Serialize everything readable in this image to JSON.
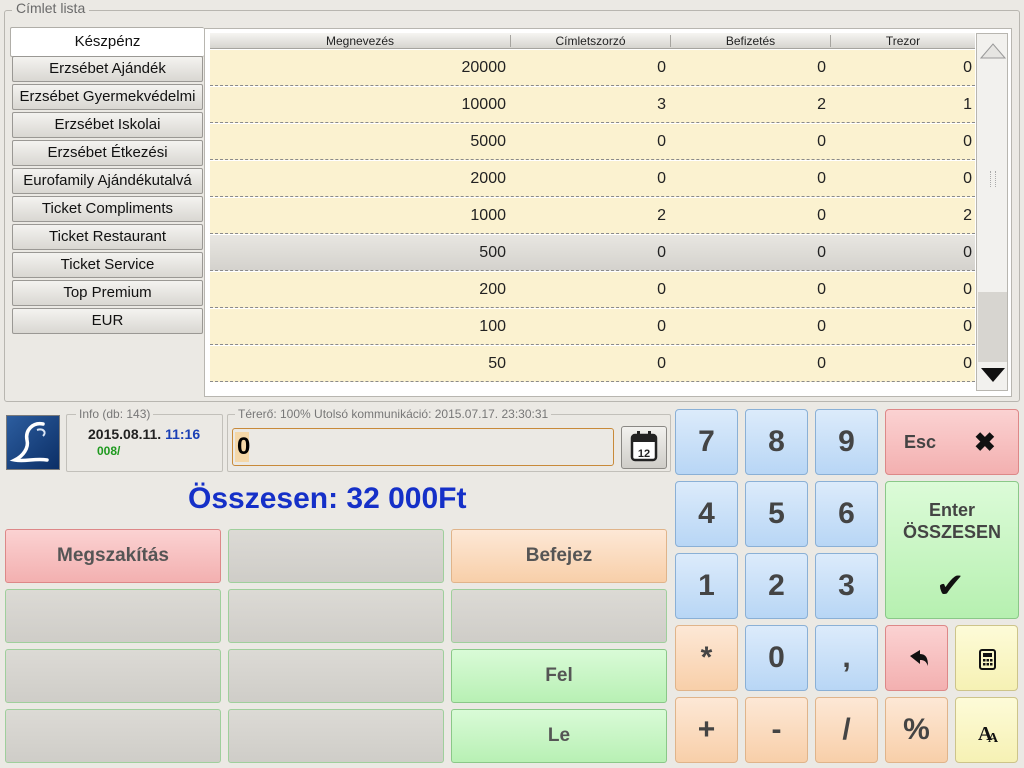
{
  "group_title": "Címlet lista",
  "categories": [
    "Készpénz",
    "Erzsébet Ajándék",
    "Erzsébet Gyermekvédelmi",
    "Erzsébet Iskolai",
    "Erzsébet Étkezési",
    "Eurofamily Ajándékutalvá",
    "Ticket Compliments",
    "Ticket Restaurant",
    "Ticket Service",
    "Top Premium",
    "EUR"
  ],
  "table": {
    "headers": [
      "Megnevezés",
      "Címletszorzó",
      "Befizetés",
      "Trezor"
    ],
    "rows": [
      [
        "20000",
        "0",
        "0",
        "0"
      ],
      [
        "10000",
        "3",
        "2",
        "1"
      ],
      [
        "5000",
        "0",
        "0",
        "0"
      ],
      [
        "2000",
        "0",
        "0",
        "0"
      ],
      [
        "1000",
        "2",
        "0",
        "2"
      ],
      [
        "500",
        "0",
        "0",
        "0"
      ],
      [
        "200",
        "0",
        "0",
        "0"
      ],
      [
        "100",
        "0",
        "0",
        "0"
      ],
      [
        "50",
        "0",
        "0",
        "0"
      ]
    ],
    "selected_row": 5
  },
  "info": {
    "title": "Info (db: 143)",
    "date": "2015.08.11.",
    "time": "11:16",
    "code": "008/"
  },
  "status": {
    "title": "Térerő: 100%  Utolsó kommunikáció: 2015.07.17. 23:30:31",
    "input_value": "0"
  },
  "total": "Összesen: 32 000Ft",
  "actions": {
    "cancel": "Megszakítás",
    "finish": "Befejez",
    "up": "Fel",
    "down": "Le"
  },
  "keypad": {
    "seven": "7",
    "eight": "8",
    "nine": "9",
    "four": "4",
    "five": "5",
    "six": "6",
    "one": "1",
    "two": "2",
    "three": "3",
    "star": "*",
    "zero": "0",
    "comma": ",",
    "plus": "+",
    "minus": "-",
    "slash": "/",
    "percent": "%",
    "esc": "Esc",
    "enter_line1": "Enter",
    "enter_line2": "ÖSSZESEN"
  },
  "colors": {
    "row_bg": "#fbf2d0",
    "total_text": "#1530c8",
    "time_text": "#1a3fb5",
    "code_text": "#1f9a1f"
  }
}
